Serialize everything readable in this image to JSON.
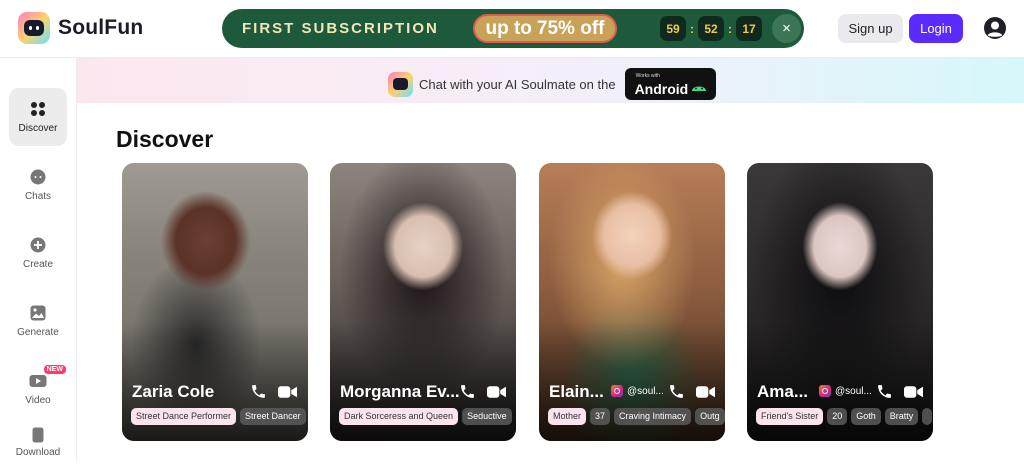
{
  "app": {
    "name": "SoulFun"
  },
  "promo": {
    "title": "FIRST SUBSCRIPTION",
    "badge_prefix": "up to",
    "badge_value": "75% off",
    "timer": [
      "59",
      "52",
      "17"
    ],
    "timer_separator": ":",
    "close": "×"
  },
  "header": {
    "signup_label": "Sign up",
    "login_label": "Login"
  },
  "sidebar": {
    "items": [
      {
        "label": "Discover",
        "icon": "grid-icon",
        "active": true
      },
      {
        "label": "Chats",
        "icon": "chat-icon"
      },
      {
        "label": "Create",
        "icon": "plus-circle-icon"
      },
      {
        "label": "Generate",
        "icon": "image-icon"
      },
      {
        "label": "Video",
        "icon": "video-icon",
        "badge": "NEW"
      },
      {
        "label": "Download",
        "icon": "phone-icon"
      }
    ]
  },
  "banner": {
    "text": "Chat with your AI Soulmate on the",
    "store_small": "Works with",
    "store_big": "Android"
  },
  "main": {
    "heading": "Discover",
    "cards": [
      {
        "name": "Zaria Cole",
        "tags": [
          "Street Dance Performer",
          "Street Dancer"
        ]
      },
      {
        "name": "Morganna Ev...",
        "tags": [
          "Dark Sorceress and Queen",
          "Seductive"
        ]
      },
      {
        "name": "Elain...",
        "social": "@soul...",
        "tags": [
          "Mother",
          "37",
          "Craving Intimacy",
          "Outg"
        ]
      },
      {
        "name": "Ama...",
        "social": "@soul...",
        "tags": [
          "Friend's Sister",
          "20",
          "Goth",
          "Bratty",
          ""
        ]
      }
    ]
  },
  "colors": {
    "accent": "#5a2bff",
    "promo_bg": "#1d5a3c",
    "promo_text": "#f3e6b8"
  }
}
